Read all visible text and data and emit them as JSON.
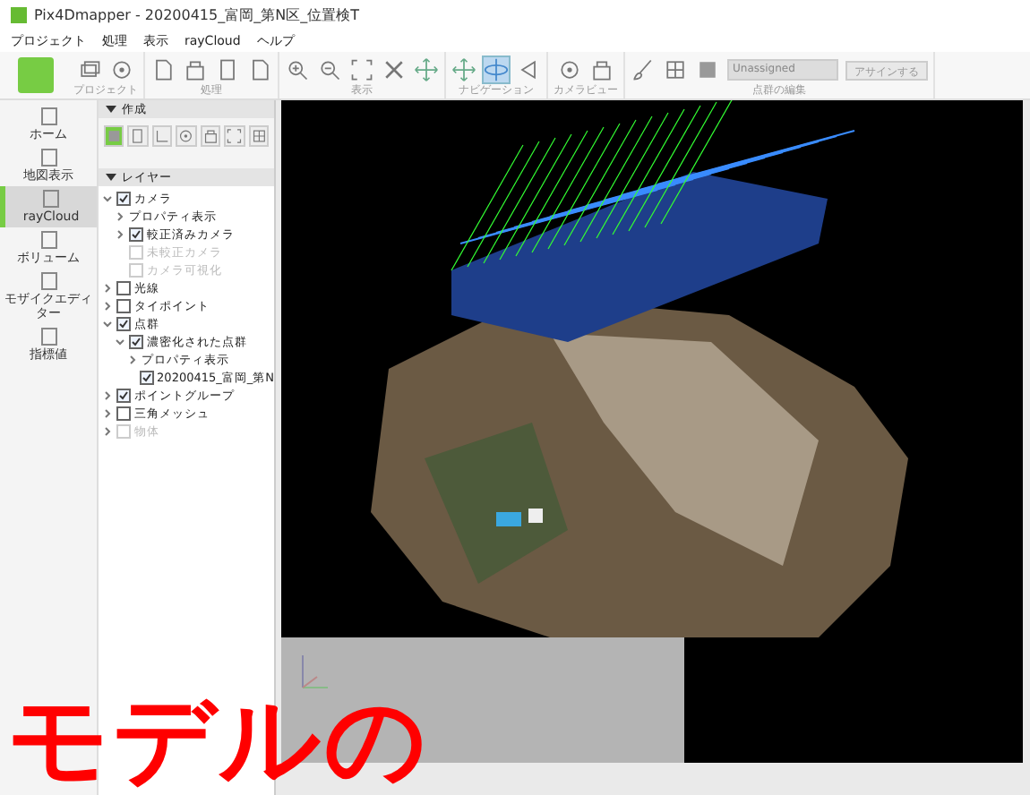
{
  "window": {
    "title": "Pix4Dmapper - 20200415_富岡_第N区_位置検T"
  },
  "menu": [
    {
      "label": "プロジェクト"
    },
    {
      "label": "処理"
    },
    {
      "label": "表示"
    },
    {
      "label": "rayCloud"
    },
    {
      "label": "ヘルプ"
    }
  ],
  "toolbar": {
    "groups": [
      {
        "label": "プロジェクト",
        "icons": [
          {
            "kind": "layers",
            "selected": false
          },
          {
            "kind": "target",
            "selected": false
          }
        ]
      },
      {
        "label": "処理",
        "icons": [
          {
            "kind": "doc",
            "selected": false
          },
          {
            "kind": "box",
            "selected": false
          },
          {
            "kind": "page",
            "selected": false
          },
          {
            "kind": "doc",
            "selected": false
          }
        ]
      },
      {
        "label": "表示",
        "icons": [
          {
            "kind": "zoomin",
            "selected": false
          },
          {
            "kind": "zoomout",
            "selected": false
          },
          {
            "kind": "fit",
            "selected": false
          },
          {
            "kind": "cross",
            "selected": false
          },
          {
            "kind": "move",
            "selected": false
          }
        ]
      },
      {
        "label": "ナビゲーション",
        "icons": [
          {
            "kind": "move",
            "selected": false
          },
          {
            "kind": "orbit",
            "selected": true
          },
          {
            "kind": "back",
            "selected": false
          }
        ]
      },
      {
        "label": "カメラビュー",
        "icons": [
          {
            "kind": "target",
            "selected": false
          },
          {
            "kind": "box",
            "selected": false
          }
        ]
      },
      {
        "label": "点群の編集",
        "icons": [
          {
            "kind": "brush",
            "selected": false
          },
          {
            "kind": "grid",
            "selected": false
          },
          {
            "kind": "square",
            "selected": false
          }
        ],
        "select": {
          "value": "Unassigned"
        },
        "button": {
          "label": "アサインする",
          "disabled": true
        }
      }
    ]
  },
  "nav": [
    {
      "label": "ホーム",
      "selected": false
    },
    {
      "label": "地図表示",
      "selected": false
    },
    {
      "label": "rayCloud",
      "selected": true
    },
    {
      "label": "ボリューム",
      "selected": false
    },
    {
      "label": "モザイクエディター",
      "selected": false
    },
    {
      "label": "指標値",
      "selected": false
    }
  ],
  "create": {
    "title": "作成",
    "expanded": true,
    "tools": [
      {
        "kind": "square",
        "selected": true
      },
      {
        "kind": "page",
        "selected": false
      },
      {
        "kind": "line",
        "selected": false
      },
      {
        "kind": "target",
        "selected": false
      },
      {
        "kind": "box",
        "selected": false
      },
      {
        "kind": "fit",
        "selected": false
      },
      {
        "kind": "grid",
        "selected": false
      }
    ]
  },
  "layers": {
    "title": "レイヤー",
    "expanded": true,
    "items": [
      {
        "label": "カメラ",
        "checked": true,
        "disabled": false,
        "expanded": true,
        "children": [
          {
            "kind": "property",
            "label": "プロパティ表示",
            "expanded": false
          },
          {
            "kind": "layer",
            "label": "較正済みカメラ",
            "checked": true,
            "disabled": false,
            "expanded": false
          },
          {
            "kind": "layer",
            "label": "未較正カメラ",
            "checked": false,
            "disabled": true
          },
          {
            "kind": "layer",
            "label": "カメラ可視化",
            "checked": false,
            "disabled": true
          }
        ]
      },
      {
        "label": "光線",
        "checked": false,
        "disabled": false,
        "expanded": false
      },
      {
        "label": "タイポイント",
        "checked": false,
        "disabled": false,
        "expanded": false
      },
      {
        "label": "点群",
        "checked": true,
        "disabled": false,
        "expanded": true,
        "children": [
          {
            "kind": "layer",
            "label": "濃密化された点群",
            "checked": true,
            "disabled": false,
            "expanded": true,
            "children": [
              {
                "kind": "property",
                "label": "プロパティ表示",
                "expanded": false
              },
              {
                "kind": "layer",
                "label": "20200415_富岡_第N",
                "checked": true,
                "disabled": false
              }
            ]
          }
        ]
      },
      {
        "label": "ポイントグループ",
        "checked": true,
        "disabled": false,
        "expanded": false
      },
      {
        "label": "三角メッシュ",
        "checked": false,
        "disabled": false,
        "expanded": false
      },
      {
        "label": "物体",
        "checked": false,
        "disabled": true,
        "expanded": false
      }
    ]
  },
  "caption": {
    "text": "モデルの"
  }
}
